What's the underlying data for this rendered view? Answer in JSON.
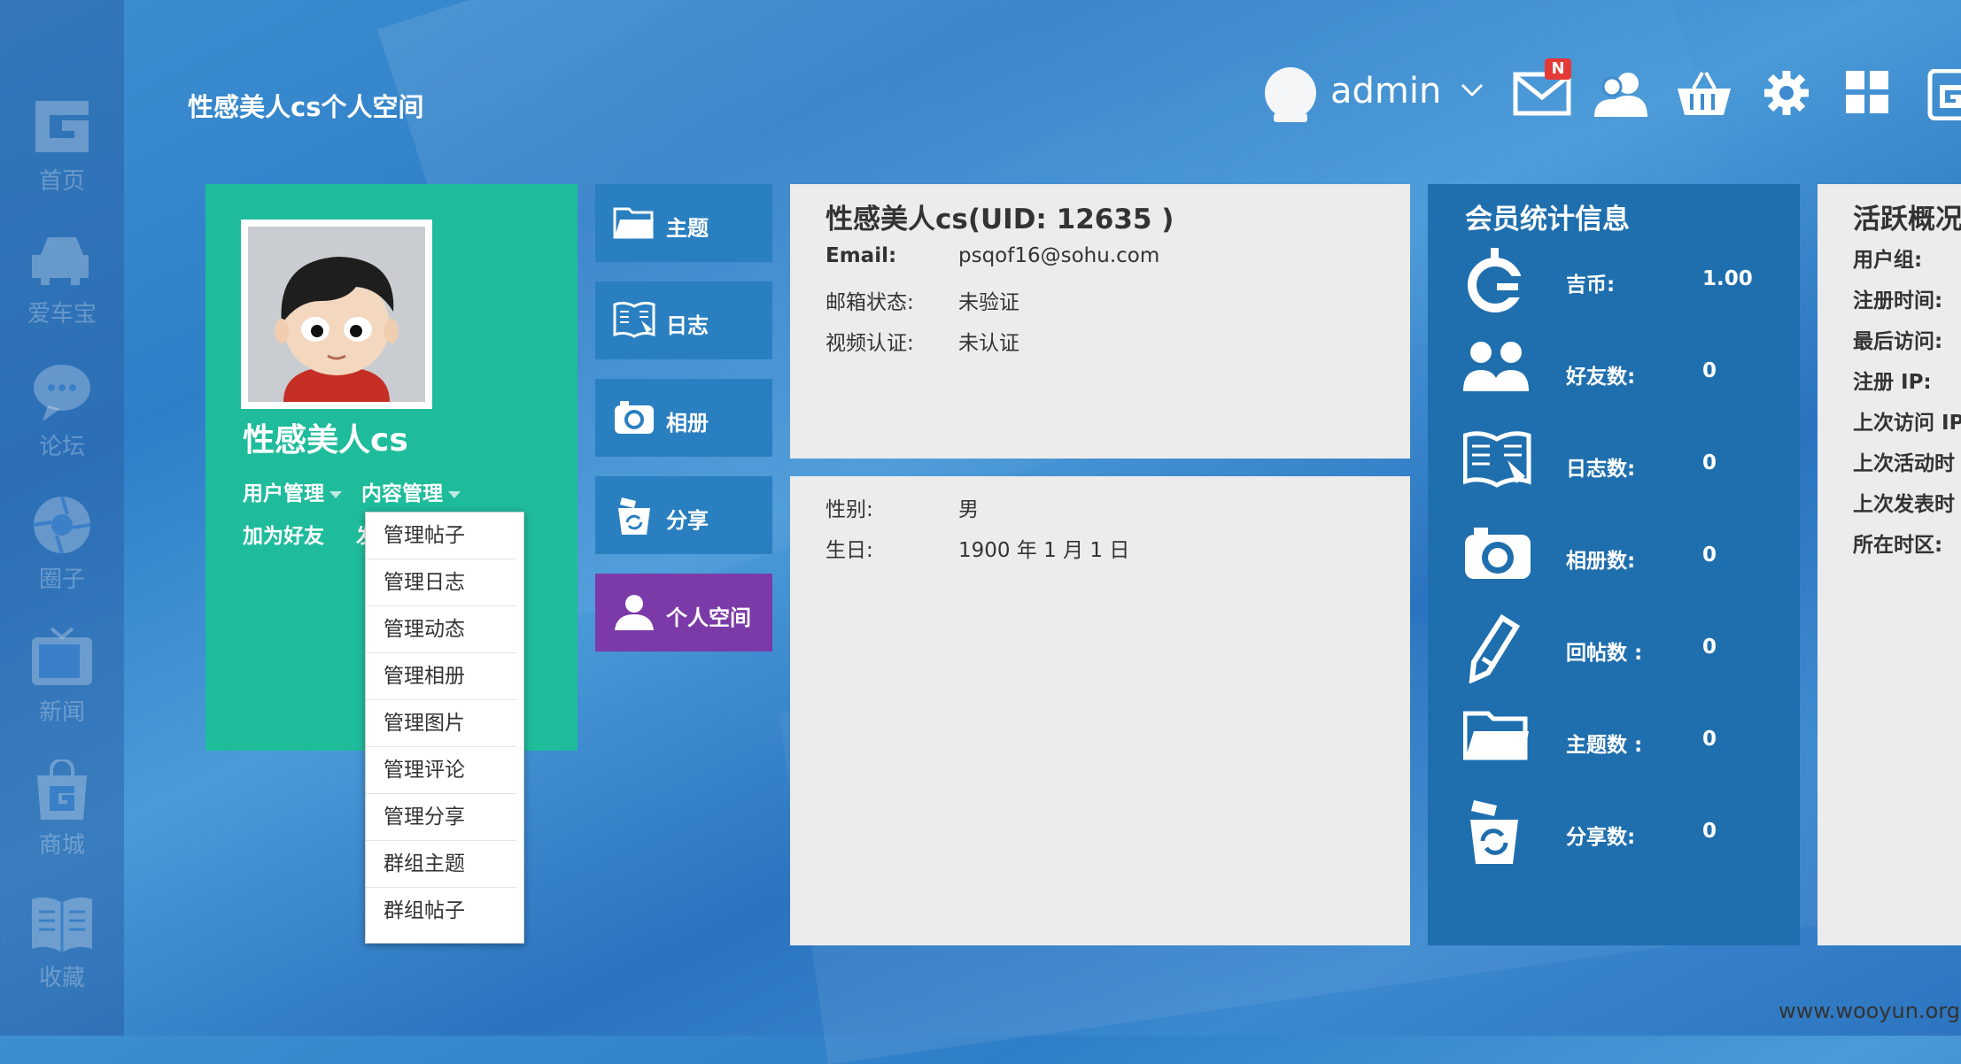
{
  "page_title": "性感美人cs个人空间",
  "sidebar": {
    "items": [
      {
        "label": "首页",
        "icon": "g-logo-icon"
      },
      {
        "label": "爱车宝",
        "icon": "car-icon"
      },
      {
        "label": "论坛",
        "icon": "chat-bubble-icon"
      },
      {
        "label": "圈子",
        "icon": "aperture-icon"
      },
      {
        "label": "新闻",
        "icon": "tv-icon"
      },
      {
        "label": "商城",
        "icon": "shopping-bag-icon"
      },
      {
        "label": "收藏",
        "icon": "book-icon"
      }
    ]
  },
  "header": {
    "username": "admin",
    "mail_badge": "N",
    "icons": [
      "user-avatar-icon",
      "chevron-down-icon",
      "mail-icon",
      "friends-icon",
      "basket-icon",
      "gear-icon",
      "grid-icon",
      "g-app-icon"
    ]
  },
  "profile": {
    "name": "性感美人cs",
    "user_manage": "用户管理",
    "content_manage": "内容管理",
    "add_friend": "加为好友",
    "partial_link": "发"
  },
  "dropdown": {
    "items": [
      "管理帖子",
      "管理日志",
      "管理动态",
      "管理相册",
      "管理图片",
      "管理评论",
      "管理分享",
      "群组主题",
      "群组帖子"
    ]
  },
  "nav_tiles": [
    {
      "label": "主题",
      "icon": "folder-icon"
    },
    {
      "label": "日志",
      "icon": "journal-icon"
    },
    {
      "label": "相册",
      "icon": "camera-icon"
    },
    {
      "label": "分享",
      "icon": "share-bin-icon"
    },
    {
      "label": "个人空间",
      "icon": "person-icon",
      "active": true
    }
  ],
  "info": {
    "title": "性感美人cs(UID: 12635 )",
    "email_label": "Email:",
    "email_value": "psqof16@sohu.com",
    "mail_status_label": "邮箱状态:",
    "mail_status_value": "未验证",
    "video_label": "视频认证:",
    "video_value": "未认证",
    "gender_label": "性别:",
    "gender_value": "男",
    "birthday_label": "生日:",
    "birthday_value": "1900 年 1 月 1 日"
  },
  "stats": {
    "title": "会员统计信息",
    "rows": [
      {
        "label": "吉币:",
        "value": "1.00",
        "icon": "g-coin-icon"
      },
      {
        "label": "好友数:",
        "value": "0",
        "icon": "friends-icon"
      },
      {
        "label": "日志数:",
        "value": "0",
        "icon": "journal-icon"
      },
      {
        "label": "相册数:",
        "value": "0",
        "icon": "camera-icon"
      },
      {
        "label": "回帖数 :",
        "value": "0",
        "icon": "pencil-icon"
      },
      {
        "label": "主题数 :",
        "value": "0",
        "icon": "folder-icon"
      },
      {
        "label": "分享数:",
        "value": "0",
        "icon": "share-bin-icon"
      }
    ]
  },
  "activity": {
    "title": "活跃概况",
    "items": [
      "用户组:",
      "注册时间:",
      "最后访问:",
      "注册 IP:",
      "上次访问 IP",
      "上次活动时",
      "上次发表时",
      "所在时区:"
    ]
  },
  "watermark": "www.wooyun.org",
  "colors": {
    "profile_green": "#1fbc9c",
    "tile_blue": "#2a7fc0",
    "tile_active_purple": "#7b3aa8",
    "stats_blue": "#1f6fae",
    "panel_gray": "#ececec"
  }
}
